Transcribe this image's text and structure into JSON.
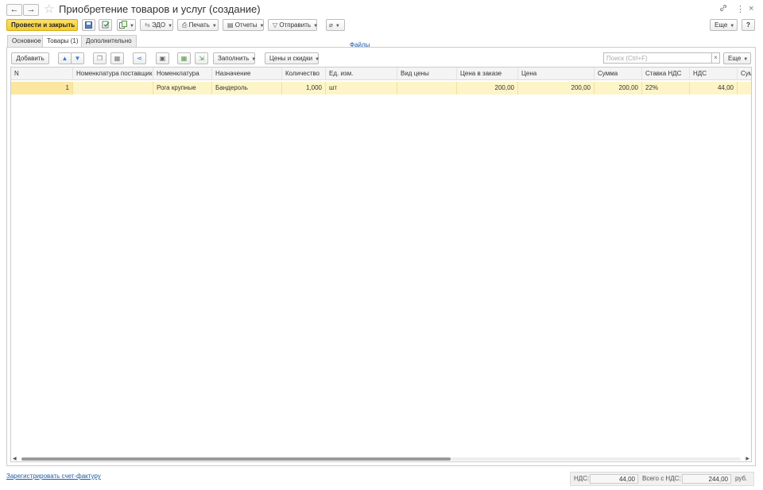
{
  "window": {
    "title": "Приобретение товаров и услуг (создание)",
    "back_icon": "←",
    "forward_icon": "→",
    "star_icon": "☆",
    "link_icon": "🔗",
    "menu_icon": "⋮",
    "close_icon": "×"
  },
  "toolbar": {
    "post_close_label": "Провести и закрыть",
    "edo_label": "ЭДО",
    "print_label": "Печать",
    "reports_label": "Отчеты",
    "send_label": "Отправить",
    "files_link": "Файлы",
    "more_label": "Еще",
    "help_label": "?"
  },
  "tabs": [
    {
      "label": "Основное"
    },
    {
      "label": "Товары (1)"
    },
    {
      "label": "Дополнительно"
    }
  ],
  "panel_toolbar": {
    "add_label": "Добавить",
    "fill_label": "Заполнить",
    "prices_label": "Цены и скидки",
    "search_placeholder": "Поиск (Ctrl+F)",
    "search_clear": "×",
    "more_label": "Еще"
  },
  "table": {
    "columns": [
      "N",
      "Номенклатура поставщика",
      "Номенклатура",
      "Назначение",
      "Количество",
      "Ед. изм.",
      "Вид цены",
      "Цена в заказе",
      "Цена",
      "Сумма",
      "Ставка НДС",
      "НДС",
      "Сум"
    ],
    "rows": [
      {
        "n": "1",
        "supplier_item": "",
        "item": "Рога крупные",
        "purpose": "Бандероль",
        "qty": "1,000",
        "unit": "шт",
        "price_type": "",
        "order_price": "200,00",
        "price": "200,00",
        "amount": "200,00",
        "vat_rate": "22%",
        "vat": "44,00",
        "total": ""
      }
    ]
  },
  "footer": {
    "invoice_link": "Зарегистрировать счет-фактуру",
    "vat_label": "НДС:",
    "vat_value": "44,00",
    "total_label": "Всего с НДС:",
    "total_value": "244,00",
    "currency": "руб."
  }
}
